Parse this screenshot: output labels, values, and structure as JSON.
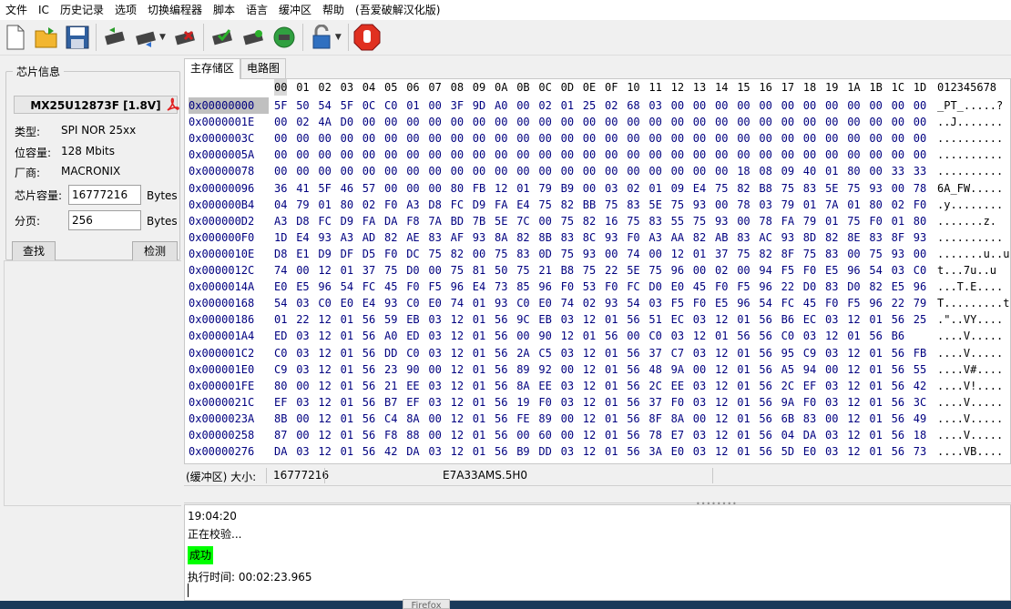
{
  "menu": [
    "文件",
    "IC",
    "历史记录",
    "选项",
    "切换编程器",
    "脚本",
    "语言",
    "缓冲区",
    "帮助",
    "(吾爱破解汉化版)"
  ],
  "toolbar": [
    {
      "name": "new-file-icon"
    },
    {
      "name": "open-folder-icon"
    },
    {
      "name": "save-icon"
    },
    {
      "name": "read-chip-icon"
    },
    {
      "name": "write-chip-icon"
    },
    {
      "name": "erase-chip-icon"
    },
    {
      "name": "verify-chip-icon"
    },
    {
      "name": "blank-check-icon"
    },
    {
      "name": "auto-program-icon"
    },
    {
      "name": "protect-lock-icon"
    },
    {
      "name": "stop-icon"
    }
  ],
  "chip_info": {
    "group_title": "芯片信息",
    "chip_name": "MX25U12873F [1.8V]",
    "type_label": "类型:",
    "type_value": "SPI NOR  25xx",
    "capacity_label": "位容量:",
    "capacity_value": "128 Mbits",
    "vendor_label": "厂商:",
    "vendor_value": "MACRONIX",
    "size_label": "芯片容量:",
    "size_value": "16777216",
    "size_unit": "Bytes",
    "page_label": "分页:",
    "page_value": "256",
    "page_unit": "Bytes",
    "search_button": "查找",
    "detect_button": "检测"
  },
  "tabs": [
    "主存储区",
    "电路图"
  ],
  "hex": {
    "columns": [
      "00",
      "01",
      "02",
      "03",
      "04",
      "05",
      "06",
      "07",
      "08",
      "09",
      "0A",
      "0B",
      "0C",
      "0D",
      "0E",
      "0F",
      "10",
      "11",
      "12",
      "13",
      "14",
      "15",
      "16",
      "17",
      "18",
      "19",
      "1A",
      "1B",
      "1C",
      "1D"
    ],
    "ascii_header": "012345678",
    "rows": [
      {
        "addr": "0x00000000",
        "bytes": "5F 50 54 5F 0C C0 01 00 3F 9D A0 00 02 01 25 02 68 03 00 00 00 00 00 00 00 00 00 00 00 00",
        "ascii": "_PT_.....?"
      },
      {
        "addr": "0x0000001E",
        "bytes": "00 02 4A D0 00 00 00 00 00 00 00 00 00 00 00 00 00 00 00 00 00 00 00 00 00 00 00 00 00 00",
        "ascii": "..J......."
      },
      {
        "addr": "0x0000003C",
        "bytes": "00 00 00 00 00 00 00 00 00 00 00 00 00 00 00 00 00 00 00 00 00 00 00 00 00 00 00 00 00 00",
        "ascii": ".........."
      },
      {
        "addr": "0x0000005A",
        "bytes": "00 00 00 00 00 00 00 00 00 00 00 00 00 00 00 00 00 00 00 00 00 00 00 00 00 00 00 00 00 00",
        "ascii": ".........."
      },
      {
        "addr": "0x00000078",
        "bytes": "00 00 00 00 00 00 00 00 00 00 00 00 00 00 00 00 00 00 00 00 00 18 08 09 40 01 80 00 33 33 30",
        "ascii": ".........."
      },
      {
        "addr": "0x00000096",
        "bytes": "36 41 5F 46 57 00 00 00 80 FB 12 01 79 B9 00 03 02 01 09 E4 75 82 B8 75 83 5E 75 93 00 78",
        "ascii": "6A_FW....."
      },
      {
        "addr": "0x000000B4",
        "bytes": "04 79 01 80 02 F0 A3 D8 FC D9 FA E4 75 82 BB 75 83 5E 75 93 00 78 03 79 01 7A 01 80 02 F0",
        "ascii": ".y........"
      },
      {
        "addr": "0x000000D2",
        "bytes": "A3 D8 FC D9 FA DA F8 7A BD 7B 5E 7C 00 75 82 16 75 83 55 75 93 00 78 FA 79 01 75 F0 01 80",
        "ascii": ".......z."
      },
      {
        "addr": "0x000000F0",
        "bytes": "1D E4 93 A3 AD 82 AE 83 AF 93 8A 82 8B 83 8C 93 F0 A3 AA 82 AB 83 AC 93 8D 82 8E 83 8F 93",
        "ascii": ".........."
      },
      {
        "addr": "0x0000010E",
        "bytes": "D8 E1 D9 DF D5 F0 DC 75 82 00 75 83 0D 75 93 00 74 00 12 01 37 75 82 8F 75 83 00 75 93 00",
        "ascii": ".......u..u"
      },
      {
        "addr": "0x0000012C",
        "bytes": "74 00 12 01 37 75 D0 00 75 81 50 75 21 B8 75 22 5E 75 96 00 02 00 94 F5 F0 E5 96 54 03 C0",
        "ascii": "t...7u..u"
      },
      {
        "addr": "0x0000014A",
        "bytes": "E0 E5 96 54 FC 45 F0 F5 96 E4 73 85 96 F0 53 F0 FC D0 E0 45 F0 F5 96 22 D0 83 D0 82 E5 96",
        "ascii": "...T.E...."
      },
      {
        "addr": "0x00000168",
        "bytes": "54 03 C0 E0 E4 93 C0 E0 74 01 93 C0 E0 74 02 93 54 03 F5 F0 E5 96 54 FC 45 F0 F5 96 22 79",
        "ascii": "T.........t"
      },
      {
        "addr": "0x00000186",
        "bytes": "01 22 12 01 56 59 EB 03 12 01 56 9C EB 03 12 01 56 51 EC 03 12 01 56 B6 EC 03 12 01 56 25",
        "ascii": ".\"..VY...."
      },
      {
        "addr": "0x000001A4",
        "bytes": "ED 03 12 01 56 A0 ED 03 12 01 56 00 90 12 01 56 00 C0 03 12 01 56 56 C0 03 12 01 56 B6",
        "ascii": "....V....."
      },
      {
        "addr": "0x000001C2",
        "bytes": "C0 03 12 01 56 DD C0 03 12 01 56 2A C5 03 12 01 56 37 C7 03 12 01 56 95 C9 03 12 01 56 FB",
        "ascii": "....V....."
      },
      {
        "addr": "0x000001E0",
        "bytes": "C9 03 12 01 56 23 90 00 12 01 56 89 92 00 12 01 56 48 9A 00 12 01 56 A5 94 00 12 01 56 55",
        "ascii": "....V#...."
      },
      {
        "addr": "0x000001FE",
        "bytes": "80 00 12 01 56 21 EE 03 12 01 56 8A EE 03 12 01 56 2C EE 03 12 01 56 2C EF 03 12 01 56 42",
        "ascii": "....V!...."
      },
      {
        "addr": "0x0000021C",
        "bytes": "EF 03 12 01 56 B7 EF 03 12 01 56 19 F0 03 12 01 56 37 F0 03 12 01 56 9A F0 03 12 01 56 3C",
        "ascii": "....V....."
      },
      {
        "addr": "0x0000023A",
        "bytes": "8B 00 12 01 56 C4 8A 00 12 01 56 FE 89 00 12 01 56 8F 8A 00 12 01 56 6B 83 00 12 01 56 49",
        "ascii": "....V....."
      },
      {
        "addr": "0x00000258",
        "bytes": "87 00 12 01 56 F8 88 00 12 01 56 00 60 00 12 01 56 78 E7 03 12 01 56 04 DA 03 12 01 56 18",
        "ascii": "....V....."
      },
      {
        "addr": "0x00000276",
        "bytes": "DA 03 12 01 56 42 DA 03 12 01 56 B9 DD 03 12 01 56 3A E0 03 12 01 56 5D E0 03 12 01 56 73",
        "ascii": "....VB...."
      }
    ]
  },
  "statusbar": {
    "buffer_label": "(缓冲区) 大小:",
    "buffer_size": "16777216",
    "checksum": "E7A33AMS.5H0"
  },
  "log": {
    "time": "19:04:20",
    "verifying": "正在校验...",
    "success": "成功",
    "elapsed_label": "执行时间:",
    "elapsed_value": "00:02:23.965"
  },
  "tooltip": "Firefox",
  "colors": {
    "hex_text": "#000080",
    "success_bg": "#00ff00",
    "stop_red": "#e03020"
  }
}
